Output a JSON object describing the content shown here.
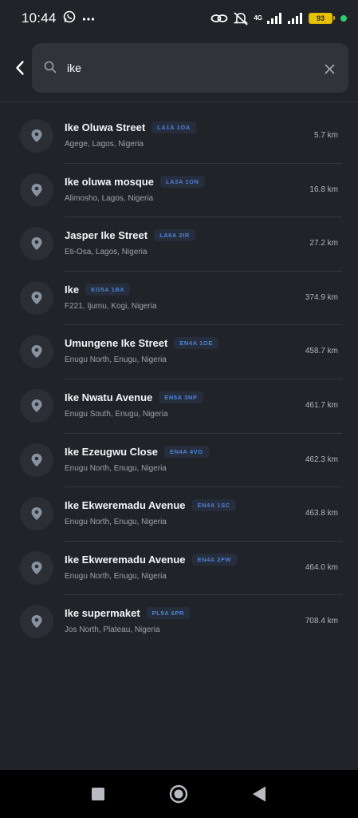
{
  "status_bar": {
    "time": "10:44",
    "network": "4G",
    "battery": "93",
    "icons": [
      "whatsapp-icon",
      "more-dots-icon",
      "hotspot-icon",
      "mute-icon",
      "signal-icon",
      "battery-icon"
    ]
  },
  "search": {
    "query": "ike",
    "icon": "search-icon",
    "clear_icon": "close-icon",
    "back_icon": "back-arrow-icon"
  },
  "results": [
    {
      "title": "Ike Oluwa Street",
      "postcode": "LA1A 1OA",
      "subtitle": "Agege, Lagos, Nigeria",
      "distance": "5.7 km"
    },
    {
      "title": "Ike oluwa mosque",
      "postcode": "LA3A 1ON",
      "subtitle": "Alimosho, Lagos, Nigeria",
      "distance": "16.8 km"
    },
    {
      "title": "Jasper Ike Street",
      "postcode": "LA6A 2IR",
      "subtitle": "Eti-Osa, Lagos, Nigeria",
      "distance": "27.2 km"
    },
    {
      "title": "Ike",
      "postcode": "KG5A 1BX",
      "subtitle": "F221, Ijumu, Kogi, Nigeria",
      "distance": "374.9 km"
    },
    {
      "title": "Umungene Ike Street",
      "postcode": "EN4A 1OE",
      "subtitle": "Enugu North, Enugu, Nigeria",
      "distance": "458.7 km"
    },
    {
      "title": "Ike Nwatu Avenue",
      "postcode": "EN5A 3NP",
      "subtitle": "Enugu South, Enugu, Nigeria",
      "distance": "461.7 km"
    },
    {
      "title": "Ike Ezeugwu Close",
      "postcode": "EN4A 4VG",
      "subtitle": "Enugu North, Enugu, Nigeria",
      "distance": "462.3 km"
    },
    {
      "title": "Ike Ekweremadu Avenue",
      "postcode": "EN4A 1SC",
      "subtitle": "Enugu North, Enugu, Nigeria",
      "distance": "463.8 km"
    },
    {
      "title": "Ike Ekweremadu Avenue",
      "postcode": "EN4A 2FW",
      "subtitle": "Enugu North, Enugu, Nigeria",
      "distance": "464.0 km"
    },
    {
      "title": "Ike supermaket",
      "postcode": "PL5A 6PR",
      "subtitle": "Jos North, Plateau, Nigeria",
      "distance": "708.4 km"
    }
  ],
  "nav_bar": {
    "icons": [
      "recent-apps-icon",
      "home-icon",
      "back-icon"
    ]
  },
  "colors": {
    "background": "#202327",
    "search_box": "#30343a",
    "pin_circle": "#2b2f35",
    "pin_icon": "#8892a0",
    "badge_text": "#4d82d6",
    "badge_bg": "#262e3d",
    "subtitle": "#9ea4ad"
  }
}
